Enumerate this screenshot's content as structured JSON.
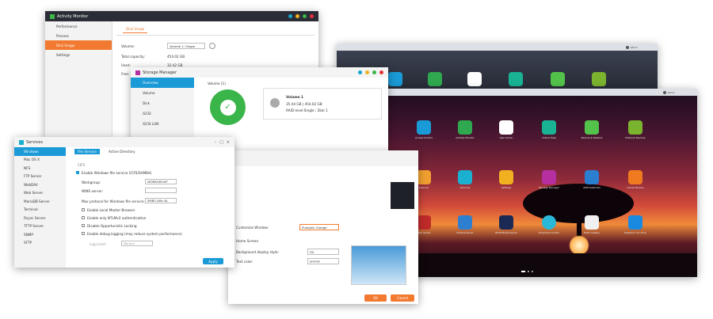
{
  "activity_monitor": {
    "title": "Activity Monitor",
    "nav": [
      "Performance",
      "Process",
      "Disk Usage",
      "Settings"
    ],
    "tab": "Disk Usage",
    "volume_label": "Volume:",
    "volume_value": "Volume 1: Single",
    "total_label": "Total capacity:",
    "total_value": "454.02 GB",
    "used_label": "Used:",
    "used_value": "32.42 GB",
    "free_label": "Free:"
  },
  "storage_manager": {
    "title": "Storage Manager",
    "nav": [
      "Overview",
      "Volume",
      "Disk",
      "iSCSI",
      "iSCSI LUN"
    ],
    "section": "Volume (1)",
    "vol_name": "Volume 1",
    "vol_size": "35.44 GB | 454.02 GB",
    "vol_raid": "RAID level:Single ; Disk 1"
  },
  "services": {
    "title": "Services",
    "nav": [
      "Windows",
      "Mac OS X",
      "NFS",
      "FTP Server",
      "WebDAV",
      "Web Server",
      "MariaDB Server",
      "Terminal",
      "Rsync Server",
      "TFTP Server",
      "SNMP",
      "SFTP"
    ],
    "tabs": [
      "File Service",
      "Active Directory"
    ],
    "cifs": "CIFS",
    "enable_cifs": "Enable Windows file service (CIFS/SAMBA)",
    "workgroup_label": "Workgroup:",
    "workgroup_value": "WORKGROUP",
    "wins_label": "WINS server:",
    "maxproto_label": "Max protocol for Windows file service:",
    "maxproto_value": "SMB3 (Win 8)",
    "opts": [
      "Enable Local Master Browser",
      "Enable only NTLMv2 authentication",
      "Disable Opportunistic Locking",
      "Enable debug logging (may reduce system performance)"
    ],
    "log_label": "Log Level:",
    "log_value": "Normal",
    "apply": "Apply"
  },
  "personal": {
    "customize_label": "Customize Window:",
    "customize_value": "Pumpkin Orange",
    "home_screen": "Home Screen",
    "bg_label": "Background display style:",
    "bg_value": "Fill",
    "text_label": "Text color:",
    "text_value": "FFFFFF",
    "ok": "OK",
    "cancel": "Cancel"
  },
  "desktop": {
    "user": "admin",
    "apps": [
      "Access Control",
      "Activity Monitor",
      "App Center",
      "Online Help",
      "Backup & Restore",
      "External Devices",
      "Explorer",
      "Services",
      "Settings",
      "Storage Manager",
      "ADM Defender",
      "Virtual Bureau",
      "Web Server",
      "Surfing Server",
      "UPnP Media Server",
      "Download Center",
      "Photo Gallery",
      "DataSync for Drop"
    ],
    "top_apps": [
      "Access Control",
      "Activity Monitor",
      "App Center",
      "Online Help",
      "Backup & Restore",
      "External Devices"
    ]
  },
  "colors": {
    "orange": "#f27a30",
    "blue": "#1a9ad6",
    "green": "#39b54a",
    "cyan": "#14a6c8"
  }
}
